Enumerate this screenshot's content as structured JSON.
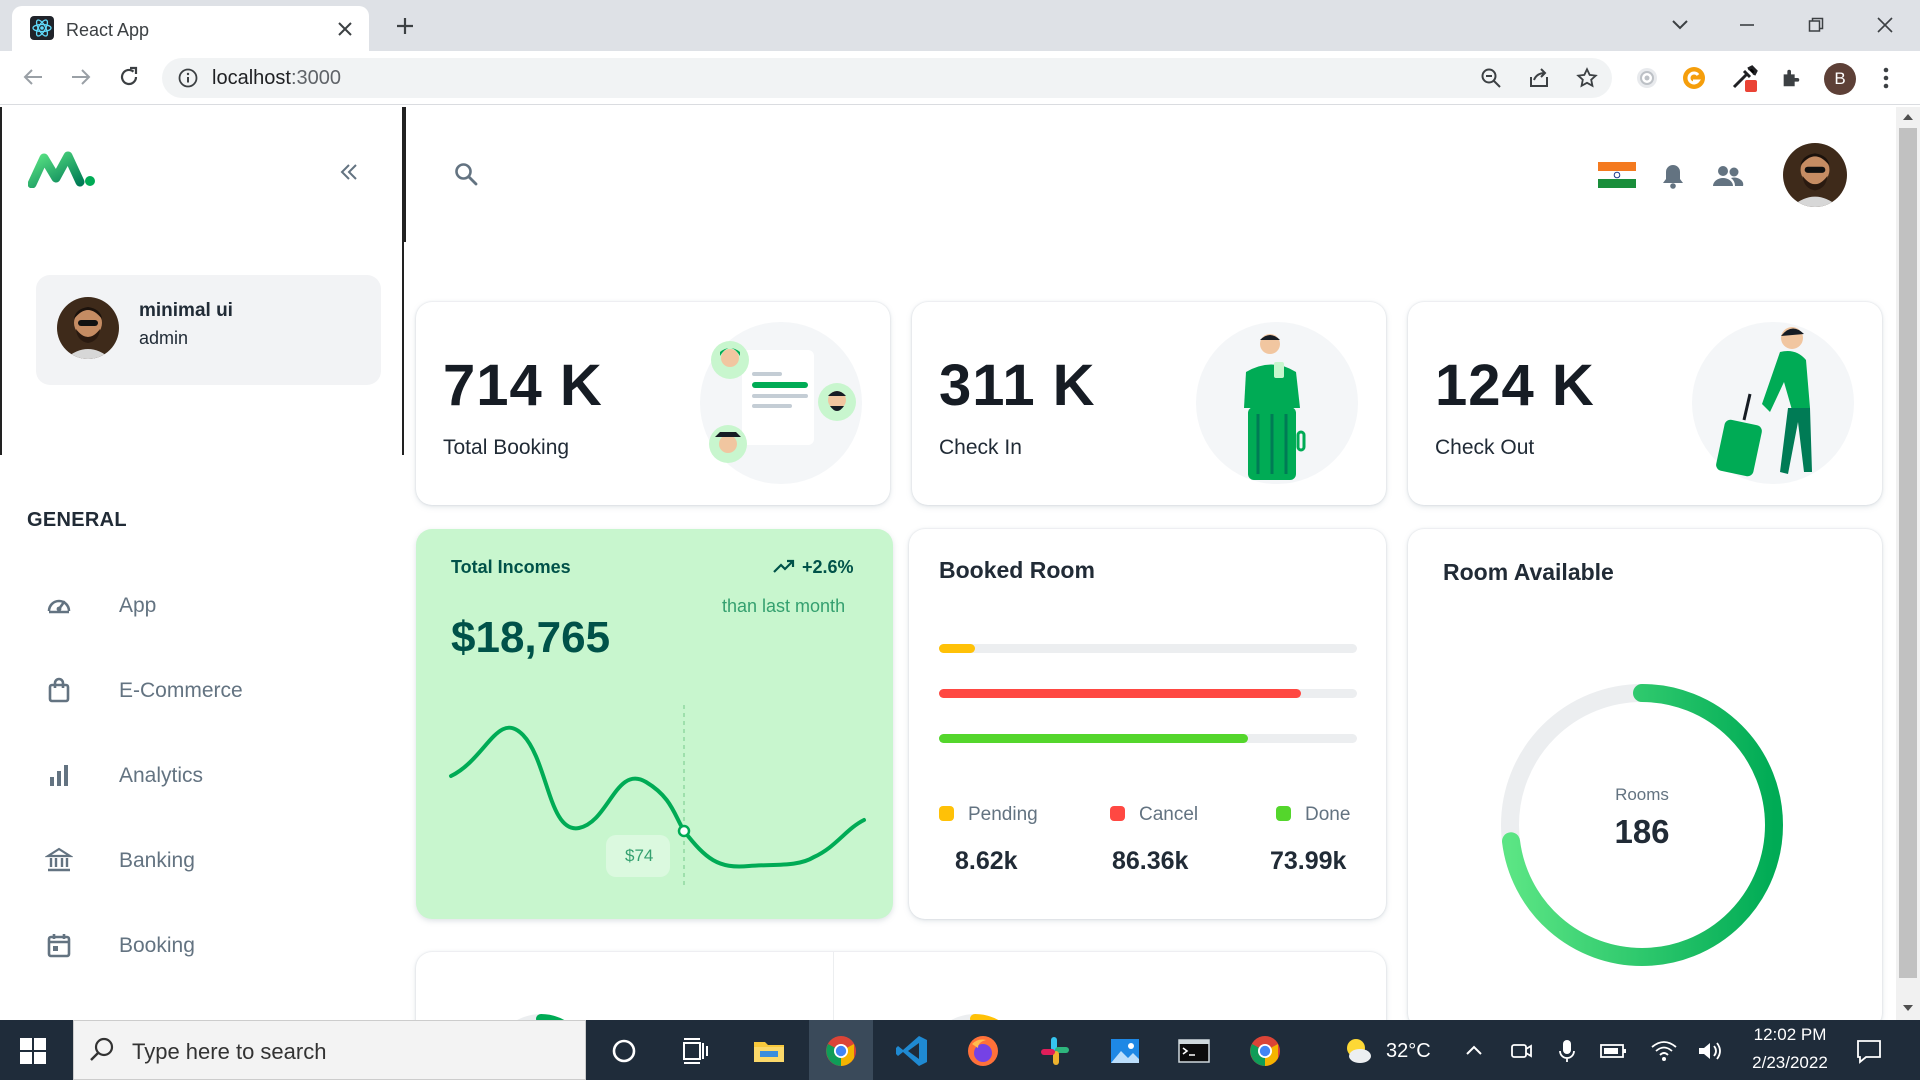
{
  "browser": {
    "tab_title": "React App",
    "url_host": "localhost",
    "url_port": ":3000",
    "profile_initial": "B"
  },
  "sidebar": {
    "account": {
      "name": "minimal ui",
      "role": "admin"
    },
    "section_title": "GENERAL",
    "items": [
      {
        "label": "App",
        "icon": "dashboard-icon"
      },
      {
        "label": "E-Commerce",
        "icon": "shopping-bag-icon"
      },
      {
        "label": "Analytics",
        "icon": "bar-chart-icon"
      },
      {
        "label": "Banking",
        "icon": "bank-icon"
      },
      {
        "label": "Booking",
        "icon": "calendar-icon"
      }
    ]
  },
  "stats": [
    {
      "value": "714 K",
      "label": "Total Booking"
    },
    {
      "value": "311 K",
      "label": "Check In"
    },
    {
      "value": "124 K",
      "label": "Check Out"
    }
  ],
  "income": {
    "title": "Total Incomes",
    "change": "+2.6%",
    "change_note": "than last month",
    "amount": "$18,765",
    "tooltip": "$74",
    "color": "#00ab55"
  },
  "booked_room": {
    "title": "Booked Room",
    "bars": [
      {
        "name": "Pending",
        "value": "8.62k",
        "fraction": 0.085,
        "color": "#ffc107"
      },
      {
        "name": "Cancel",
        "value": "86.36k",
        "fraction": 0.865,
        "color": "#ff4842"
      },
      {
        "name": "Done",
        "value": "73.99k",
        "fraction": 0.74,
        "color": "#54d62c"
      }
    ]
  },
  "room_available": {
    "title": "Room Available",
    "center_label": "Rooms",
    "center_value": "186",
    "fraction": 0.73
  },
  "taskbar": {
    "search_placeholder": "Type here to search",
    "weather": "32°C",
    "time": "12:02 PM",
    "date": "2/23/2022"
  },
  "colors": {
    "primary": "#00ab55",
    "income_bg": "#c8f6ce",
    "text": "#212b36",
    "muted": "#637381"
  }
}
